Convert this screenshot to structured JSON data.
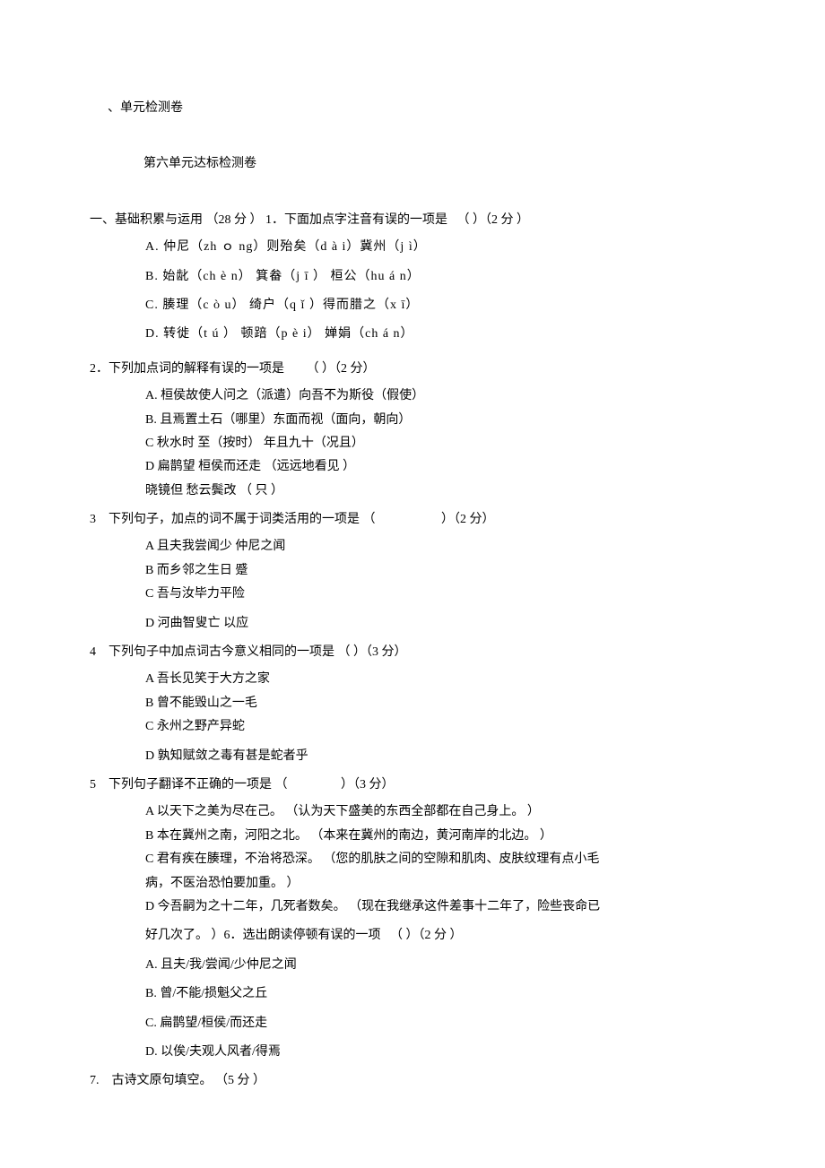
{
  "header": "、单元检测卷",
  "title": "第六单元达标检测卷",
  "section1": {
    "header": "一、基础积累与运用 （28 分 ） 1．下面加点字注音有误的一项是 　（ ）（2 分 ）",
    "opts": {
      "A": "A.  仲尼（zh ｏ ng）则殆矣（d à i）冀州（j ì）",
      "B": "B.  始龀（ch è n） 箕畚（j ī ） 桓公（hu á n）",
      "C": "C.  腠理（c ò u） 绮户（q ǐ ）得而腊之（x ī）",
      "D": "D.  转徙（t ú ） 顿踣（p è i） 婵娟（ch á n）"
    }
  },
  "q2": {
    "text": "2．下列加点词的解释有误的一项是 　　（ ）（2 分）",
    "opts": {
      "A": "A.  桓侯故使人问之（派遣）向吾不为斯役（假使）",
      "B": "B.  且焉置土石（哪里）东面而视（面向，朝向）",
      "C": "C 秋水时  至（按时） 年且九十（况且）",
      "D": "D 扁鹊望  桓侯而还走 （远远地看见 ）",
      "extra": "晓镜但 愁云鬓改 （ 只 ）"
    }
  },
  "q3": {
    "text": "3　下列句子，加点的词不属于词类活用的一项是 （ 　　　　　）（2 分）",
    "opts": {
      "A": "A 且夫我尝闻少  仲尼之闻",
      "B": "B 而乡邻之生日  蹙",
      "C": "C 吾与汝毕力平险",
      "D": "D 河曲智叟亡  以应"
    }
  },
  "q4": {
    "text": "4　下列句子中加点词古今意义相同的一项是 （ ）（3 分）",
    "opts": {
      "A": "A 吾长见笑于大方之家",
      "B": "B 曾不能毁山之一毛",
      "C": "C 永州之野产异蛇",
      "D": "D 孰知赋敛之毒有甚是蛇者乎"
    }
  },
  "q5": {
    "text": "5　下列句子翻译不正确的一项是 （ 　　　　）（3 分）",
    "opts": {
      "A": "A 以天下之美为尽在己。 （认为天下盛美的东西全部都在自己身上。 ）",
      "B": "B 本在冀州之南，河阳之北。 （本来在冀州的南边，黄河南岸的北边。 ）",
      "C1": "C 君有疾在腠理，不治将恐深。 （您的肌肤之间的空隙和肌肉、皮肤纹理有点小毛",
      "C2": "病，不医治恐怕要加重。 ）",
      "D1": "D 今吾嗣为之十二年，几死者数矣。 （现在我继承这件差事十二年了，险些丧命已",
      "D2": "好几次了。 ）6．选出朗读停顿有误的一项 　（ ）（2 分 ）"
    }
  },
  "q6": {
    "opts": {
      "A": "A.  且夫/我/尝闻/少仲尼之闻",
      "B": "B.  曾/不能/损魁父之丘",
      "C": "C.  扁鹊望/桓侯/而还走",
      "D": "D.  以俟/夫观人风者/得焉"
    }
  },
  "q7": {
    "text": "7.　古诗文原句填空。 （5 分 ）"
  }
}
